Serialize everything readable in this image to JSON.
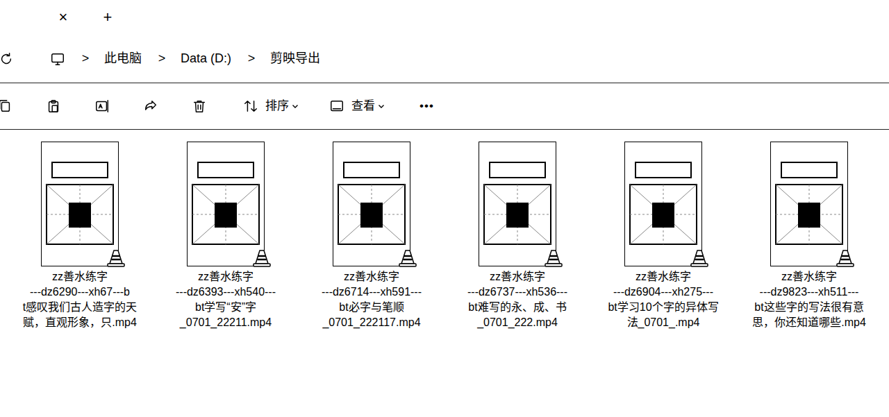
{
  "tab": {
    "close": "×"
  },
  "new_tab": "+",
  "breadcrumb": [
    {
      "sep": ">",
      "label": "此电脑"
    },
    {
      "sep": ">",
      "label": "Data (D:)"
    },
    {
      "sep": ">",
      "label": "剪映导出"
    }
  ],
  "toolbar": {
    "sort": "排序",
    "view": "查看",
    "more": "•••"
  },
  "files": [
    {
      "name_lines": [
        "zz善水练字",
        "---dz6290---xh67---b",
        "t感叹我们古人造字的天",
        "赋，直观形象，只.mp4"
      ]
    },
    {
      "name_lines": [
        "zz善水练字",
        "---dz6393---xh540---",
        "bt学写“安”字",
        "_0701_22211.mp4"
      ]
    },
    {
      "name_lines": [
        "zz善水练字",
        "---dz6714---xh591---",
        "bt必字与笔顺",
        "_0701_222117.mp4"
      ]
    },
    {
      "name_lines": [
        "zz善水练字",
        "---dz6737---xh536---",
        "bt难写的永、成、书",
        "_0701_222.mp4"
      ]
    },
    {
      "name_lines": [
        "zz善水练字",
        "---dz6904---xh275---",
        "bt学习10个字的异体写",
        "法_0701_.mp4"
      ]
    },
    {
      "name_lines": [
        "zz善水练字",
        "---dz9823---xh511---",
        "bt这些字的写法很有意",
        "思，你还知道哪些.mp4"
      ]
    }
  ]
}
